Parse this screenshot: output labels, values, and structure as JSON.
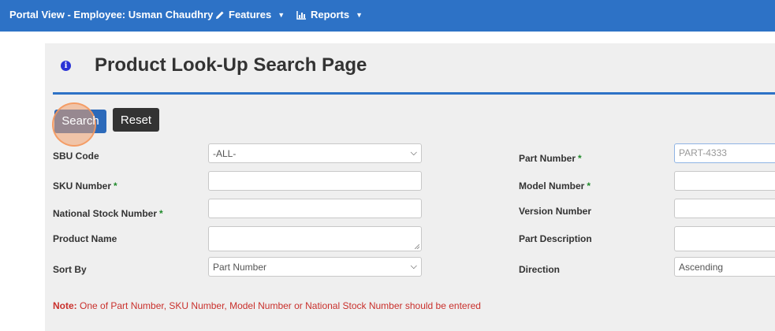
{
  "navbar": {
    "brand": "Portal View - Employee: Usman Chaudhry",
    "features_label": "Features",
    "reports_label": "Reports",
    "caret": "▼"
  },
  "page": {
    "title": "Product Look-Up Search Page",
    "info_glyph": "i"
  },
  "buttons": {
    "search_label": "Search",
    "reset_label": "Reset"
  },
  "form": {
    "sbu_code": {
      "label": "SBU Code",
      "value": "-ALL-"
    },
    "sku_number": {
      "label": "SKU Number",
      "required": "*",
      "value": ""
    },
    "national_stock_number": {
      "label": "National Stock Number",
      "required": "*",
      "value": ""
    },
    "product_name": {
      "label": "Product Name",
      "value": ""
    },
    "sort_by": {
      "label": "Sort By",
      "value": "Part Number"
    },
    "part_number": {
      "label": "Part Number",
      "required": "*",
      "value": "PART-4333"
    },
    "model_number": {
      "label": "Model Number",
      "required": "*",
      "value": ""
    },
    "version_number": {
      "label": "Version Number",
      "value": ""
    },
    "part_description": {
      "label": "Part Description",
      "value": ""
    },
    "direction": {
      "label": "Direction",
      "value": "Ascending"
    }
  },
  "note": {
    "prefix": "Note:",
    "text": " One of Part Number, SKU Number, Model Number or National Stock Number should be entered"
  },
  "colors": {
    "navbar": "#2d72c6",
    "primary_button": "#2c6aba",
    "reset_button": "#333333",
    "required_marker": "#1f8a2a",
    "note_text": "#c9302c"
  }
}
